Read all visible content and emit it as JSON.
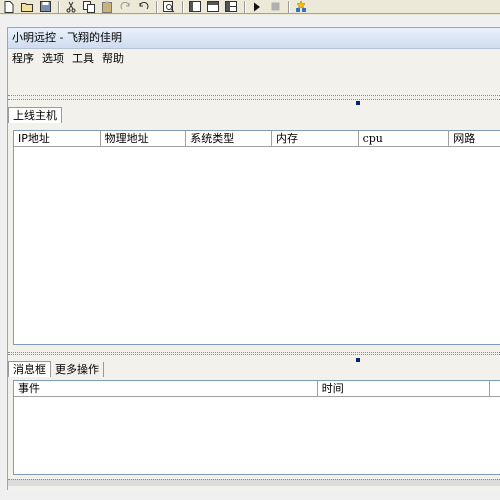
{
  "window": {
    "title": "小明远控 - 飞翔的佳明"
  },
  "menu": {
    "items": [
      "程序",
      "选项",
      "工具",
      "帮助"
    ]
  },
  "hosts_panel": {
    "tab_label": "上线主机",
    "columns": [
      "IP地址",
      "物理地址",
      "系统类型",
      "内存",
      "cpu",
      "网路"
    ]
  },
  "messages_panel": {
    "tabs": [
      "消息框",
      "更多操作"
    ],
    "columns": [
      "事件",
      "时间"
    ]
  },
  "toolbar": {
    "icons": [
      "new-file-icon",
      "open-folder-icon",
      "save-icon",
      "cut-icon",
      "copy-icon",
      "paste-icon",
      "redo-icon",
      "undo-icon",
      "find-icon",
      "layout-left-icon",
      "layout-top-icon",
      "layout-grid-icon",
      "run-icon",
      "stop-icon",
      "build-icon"
    ]
  }
}
